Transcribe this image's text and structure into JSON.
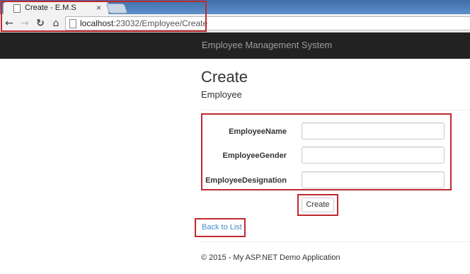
{
  "browser": {
    "tab_title": "Create - E.M.S",
    "tab_close": "×",
    "url_host": "localhost",
    "url_path": ":23032/Employee/Create",
    "icons": {
      "back": "back-arrow-icon",
      "forward": "forward-arrow-icon",
      "reload": "reload-icon",
      "home": "home-icon",
      "page": "page-icon"
    }
  },
  "appbar": {
    "brand": "Employee Management System"
  },
  "page": {
    "title": "Create",
    "subtitle": "Employee",
    "form": {
      "fields": [
        {
          "label": "EmployeeName",
          "value": ""
        },
        {
          "label": "EmployeeGender",
          "value": ""
        },
        {
          "label": "EmployeeDesignation",
          "value": ""
        }
      ],
      "submit_label": "Create"
    },
    "back_link": "Back to List",
    "footer": "© 2015 - My ASP.NET Demo Application"
  },
  "colors": {
    "highlight": "#c0282e",
    "navbar": "#222222",
    "link": "#428bca"
  }
}
